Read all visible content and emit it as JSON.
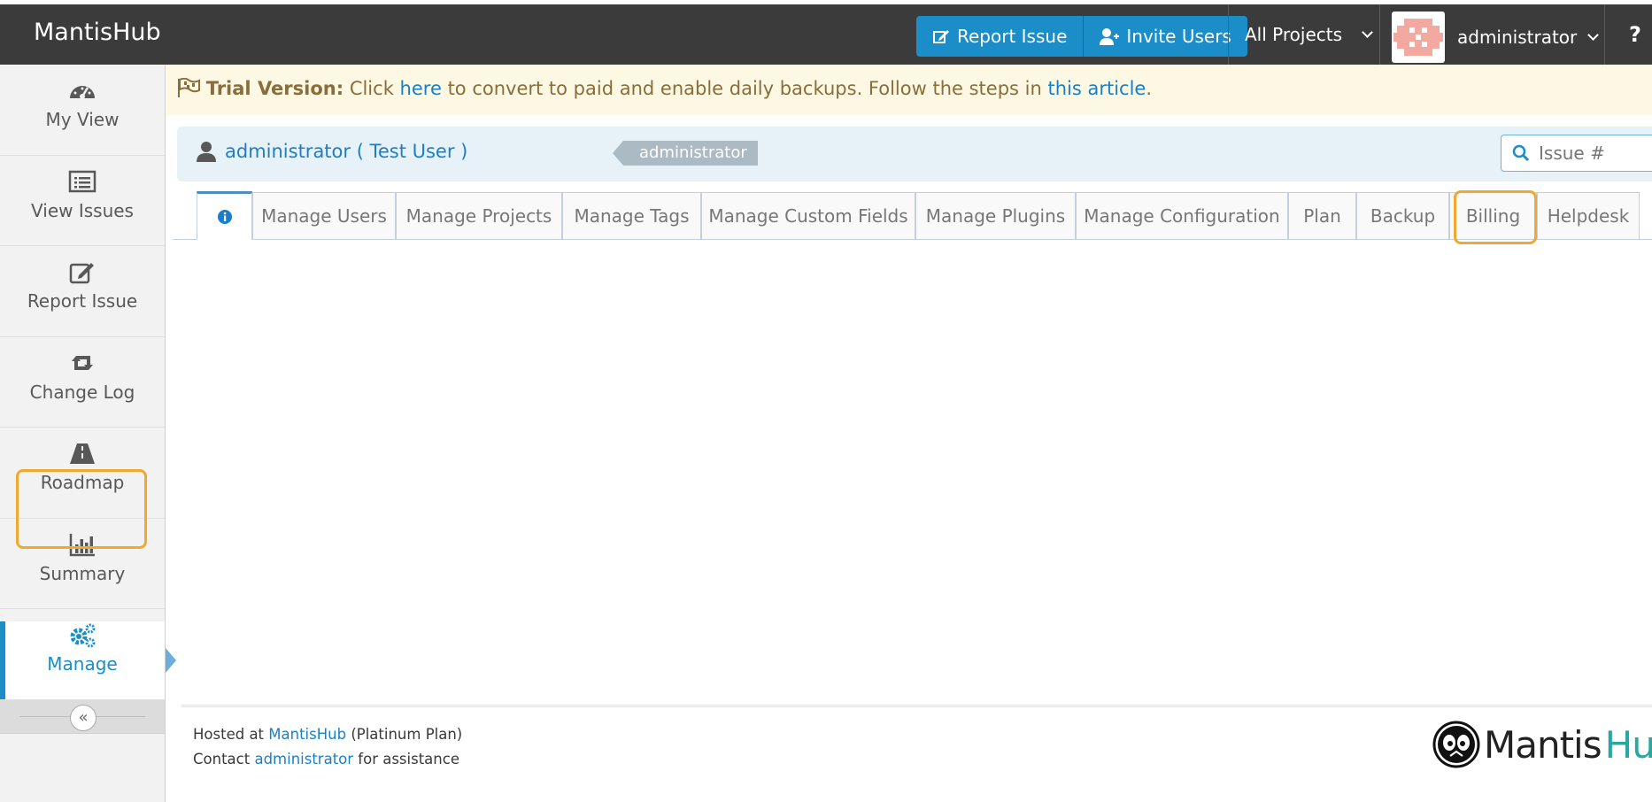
{
  "navbar": {
    "brand": "MantisHub",
    "report_issue": "Report Issue",
    "invite_users": "Invite Users",
    "projects": "All Projects",
    "user": "administrator",
    "help": "?"
  },
  "sidebar": {
    "items": [
      {
        "label": "My View",
        "icon": "dashboard-icon"
      },
      {
        "label": "View Issues",
        "icon": "list-icon"
      },
      {
        "label": "Report Issue",
        "icon": "edit-icon"
      },
      {
        "label": "Change Log",
        "icon": "retweet-icon"
      },
      {
        "label": "Roadmap",
        "icon": "road-icon"
      },
      {
        "label": "Summary",
        "icon": "bar-chart-icon"
      },
      {
        "label": "Manage",
        "icon": "gears-icon",
        "active": true
      }
    ],
    "collapse": "«"
  },
  "trial": {
    "title": "Trial Version:",
    "text1": "Click",
    "link1": "here",
    "text2": "to convert to paid and enable daily backups. Follow the steps in",
    "link2": "this article",
    "text3": "."
  },
  "crumb": {
    "user": "administrator ( Test User )",
    "role": "administrator",
    "search_placeholder": "Issue #"
  },
  "tabs": [
    {
      "label": "",
      "icon": "info-icon",
      "active": true
    },
    {
      "label": "Manage Users"
    },
    {
      "label": "Manage Projects"
    },
    {
      "label": "Manage Tags"
    },
    {
      "label": "Manage Custom Fields"
    },
    {
      "label": "Manage Plugins"
    },
    {
      "label": "Manage Configuration"
    },
    {
      "label": "Plan"
    },
    {
      "label": "Backup"
    },
    {
      "label": "Billing"
    },
    {
      "label": "Helpdesk"
    }
  ],
  "footer": {
    "hosted_prefix": "Hosted at",
    "hosted_link": "MantisHub",
    "hosted_suffix": "(Platinum Plan)",
    "contact_prefix": "Contact",
    "contact_link": "administrator",
    "contact_suffix": "for assistance",
    "logo_a": "Mantis",
    "logo_b": "Hub"
  },
  "colors": {
    "navbar": "#3b3b3b",
    "primary": "#1b8dc9",
    "highlight": "#f0a930",
    "trial_bg": "#fcf8e3"
  }
}
